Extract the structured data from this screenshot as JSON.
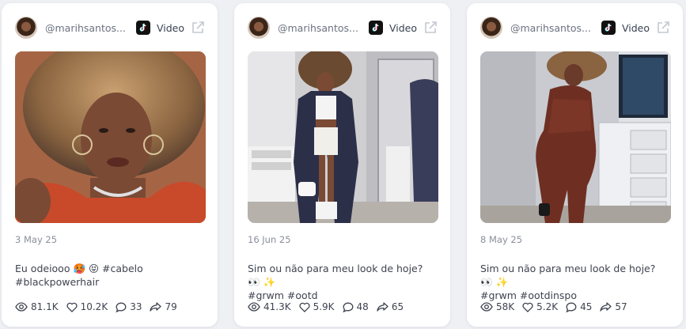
{
  "colors": {
    "card_bg": "#ffffff",
    "page_bg": "#eef0f4",
    "muted": "#8a8f9a"
  },
  "icons": [
    "tiktok-icon",
    "external-link-icon",
    "eye-icon",
    "heart-icon",
    "comment-icon",
    "share-icon"
  ],
  "cards": [
    {
      "handle": "@marihsantos...",
      "platform_label": "Video",
      "date": "3 May 25",
      "caption_line1": "Eu odeiooo 🥵 😝 #cabelo",
      "caption_line2": "#blackpowerhair",
      "views": "81.1K",
      "likes": "10.2K",
      "comments": "33",
      "shares": "79"
    },
    {
      "handle": "@marihsantos...",
      "platform_label": "Video",
      "date": "16 Jun 25",
      "caption_line1": "Sim ou não para meu look de hoje? 👀 ✨",
      "caption_line2": "#grwm #ootd",
      "views": "41.3K",
      "likes": "5.9K",
      "comments": "48",
      "shares": "65"
    },
    {
      "handle": "@marihsantos...",
      "platform_label": "Video",
      "date": "8 May 25",
      "caption_line1": "Sim ou não para meu look de hoje? 👀 ✨",
      "caption_line2": "#grwm #ootdinspo",
      "views": "58K",
      "likes": "5.2K",
      "comments": "45",
      "shares": "57"
    }
  ]
}
